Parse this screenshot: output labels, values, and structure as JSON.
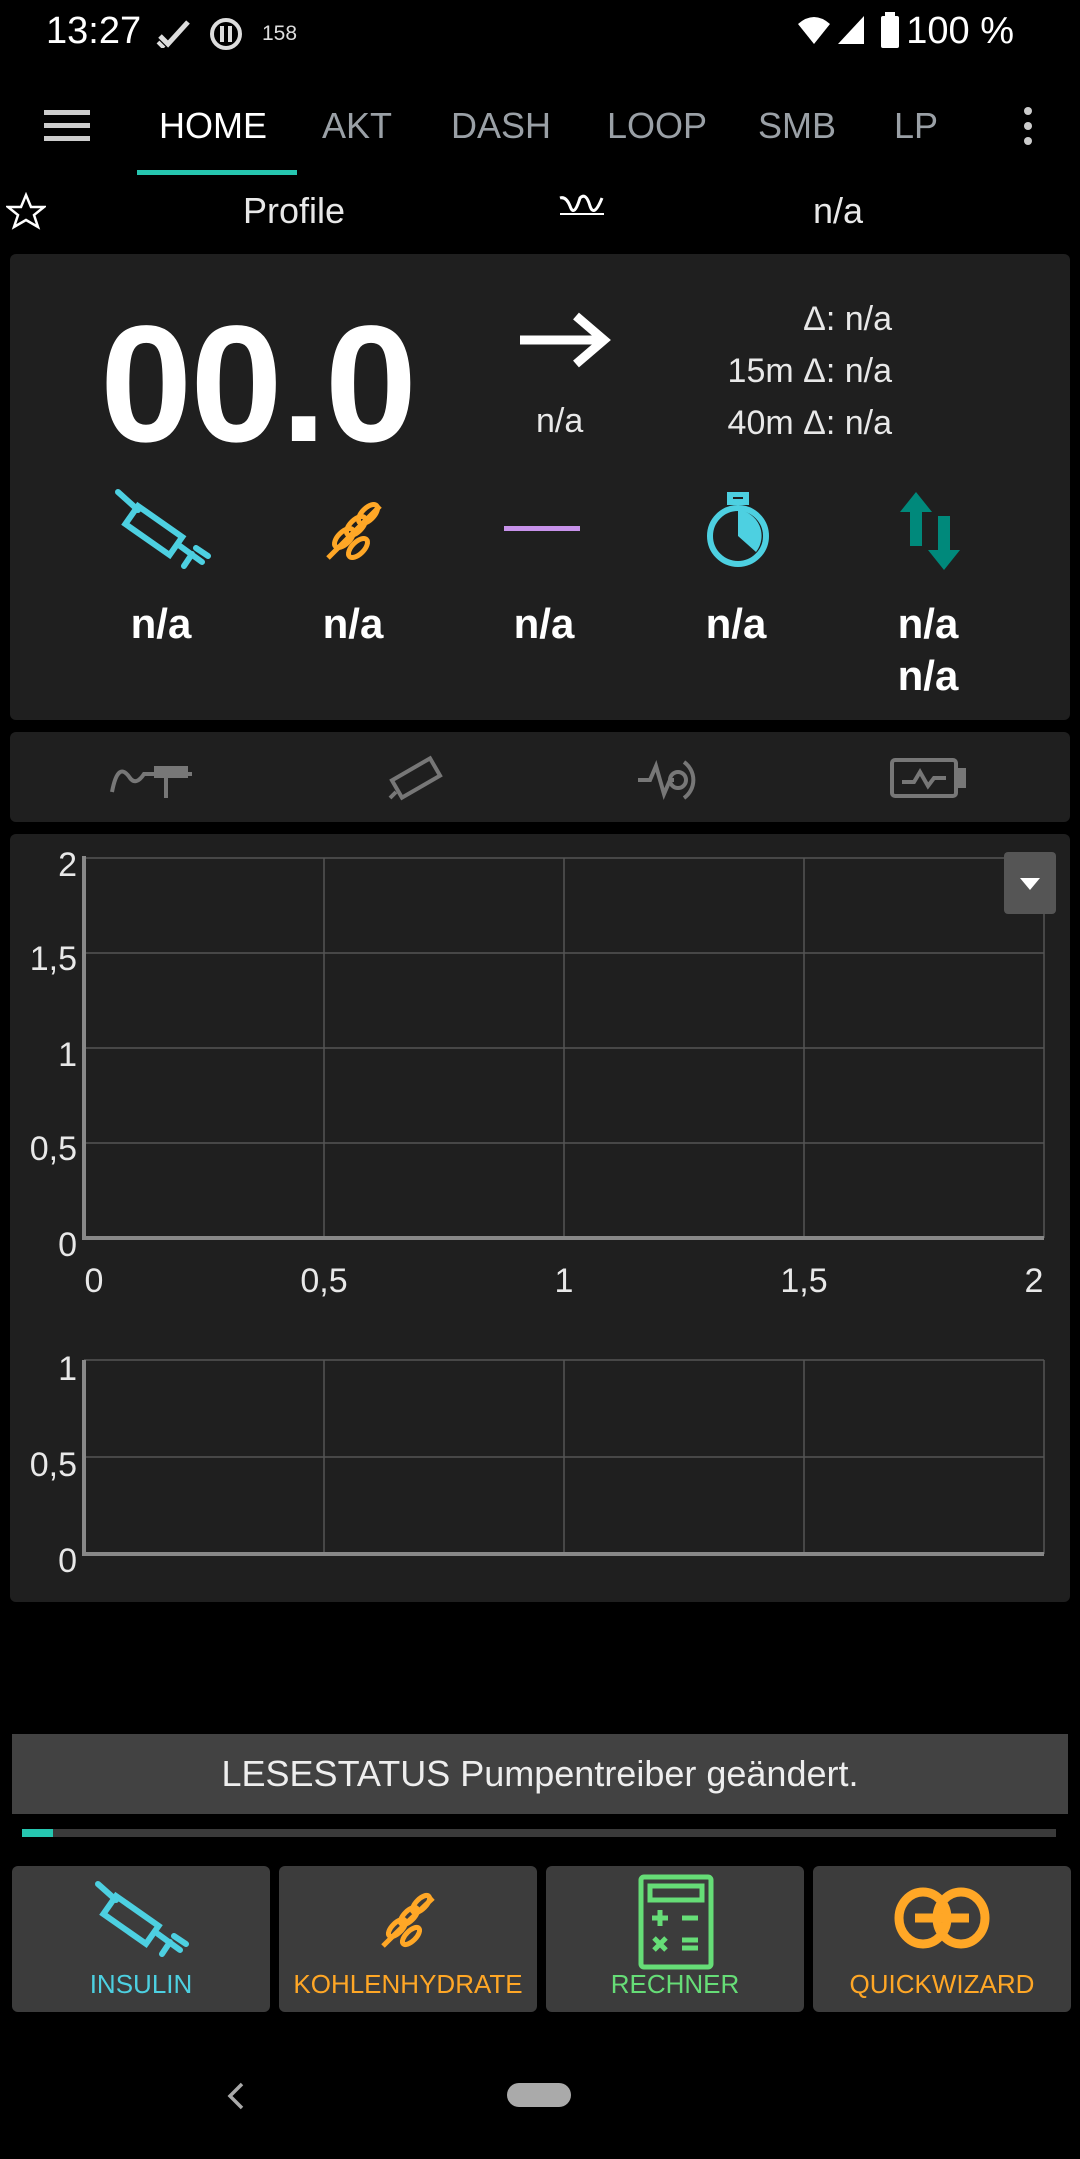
{
  "status_bar": {
    "time": "13:27",
    "notification_count": "158",
    "battery": "100 %"
  },
  "tabs": [
    {
      "label": "HOME",
      "active": true
    },
    {
      "label": "AKT",
      "active": false
    },
    {
      "label": "DASH",
      "active": false
    },
    {
      "label": "LOOP",
      "active": false
    },
    {
      "label": "SMB",
      "active": false
    },
    {
      "label": "LP",
      "active": false
    }
  ],
  "profile_row": {
    "profile_label": "Profile",
    "target_value": "n/a"
  },
  "glucose": {
    "value": "00.0",
    "trend_icon": "arrow-right-icon",
    "trend_value": "n/a",
    "delta": "Δ: n/a",
    "delta_15m": "15m Δ: n/a",
    "delta_40m": "40m Δ: n/a"
  },
  "stats": {
    "insulin": "n/a",
    "carbs": "n/a",
    "basal": "n/a",
    "timer": "n/a",
    "autosens_1": "n/a",
    "autosens_2": "n/a"
  },
  "icons": {
    "insulin": "syringe-icon",
    "carbs": "wheat-icon",
    "basal": "basal-line-icon",
    "timer": "stopwatch-icon",
    "autosens": "up-down-arrows-icon",
    "cannula": "cannula-icon",
    "reservoir": "reservoir-icon",
    "sensor": "sensor-icon",
    "pump_battery": "pump-battery-icon",
    "calculator": "calculator-icon",
    "quickwizard": "pretzel-icon"
  },
  "chart_data": [
    {
      "type": "line",
      "series": [],
      "x_ticks": [
        "0",
        "0,5",
        "1",
        "1,5",
        "2"
      ],
      "y_ticks": [
        "0",
        "0,5",
        "1",
        "1,5",
        "2"
      ],
      "xlim": [
        0,
        2
      ],
      "ylim": [
        0,
        2
      ],
      "grid": true
    },
    {
      "type": "line",
      "series": [],
      "y_ticks": [
        "0",
        "0,5",
        "1"
      ],
      "xlim": [
        0,
        2
      ],
      "ylim": [
        0,
        1
      ],
      "grid": true
    }
  ],
  "notification": "LESESTATUS Pumpentreiber geändert.",
  "progress": 0.03,
  "actions": [
    {
      "label": "INSULIN",
      "color": "#4dd0e1"
    },
    {
      "label": "KOHLENHYDRATE",
      "color": "#ffa726"
    },
    {
      "label": "RECHNER",
      "color": "#66dd77"
    },
    {
      "label": "QUICKWIZARD",
      "color": "#ffa726"
    }
  ],
  "colors": {
    "accent": "#26c6b0",
    "insulin": "#4dd0e1",
    "carbs": "#ffa726",
    "basal": "#c792ea",
    "autosens": "#00897b",
    "calculator": "#66dd77"
  }
}
